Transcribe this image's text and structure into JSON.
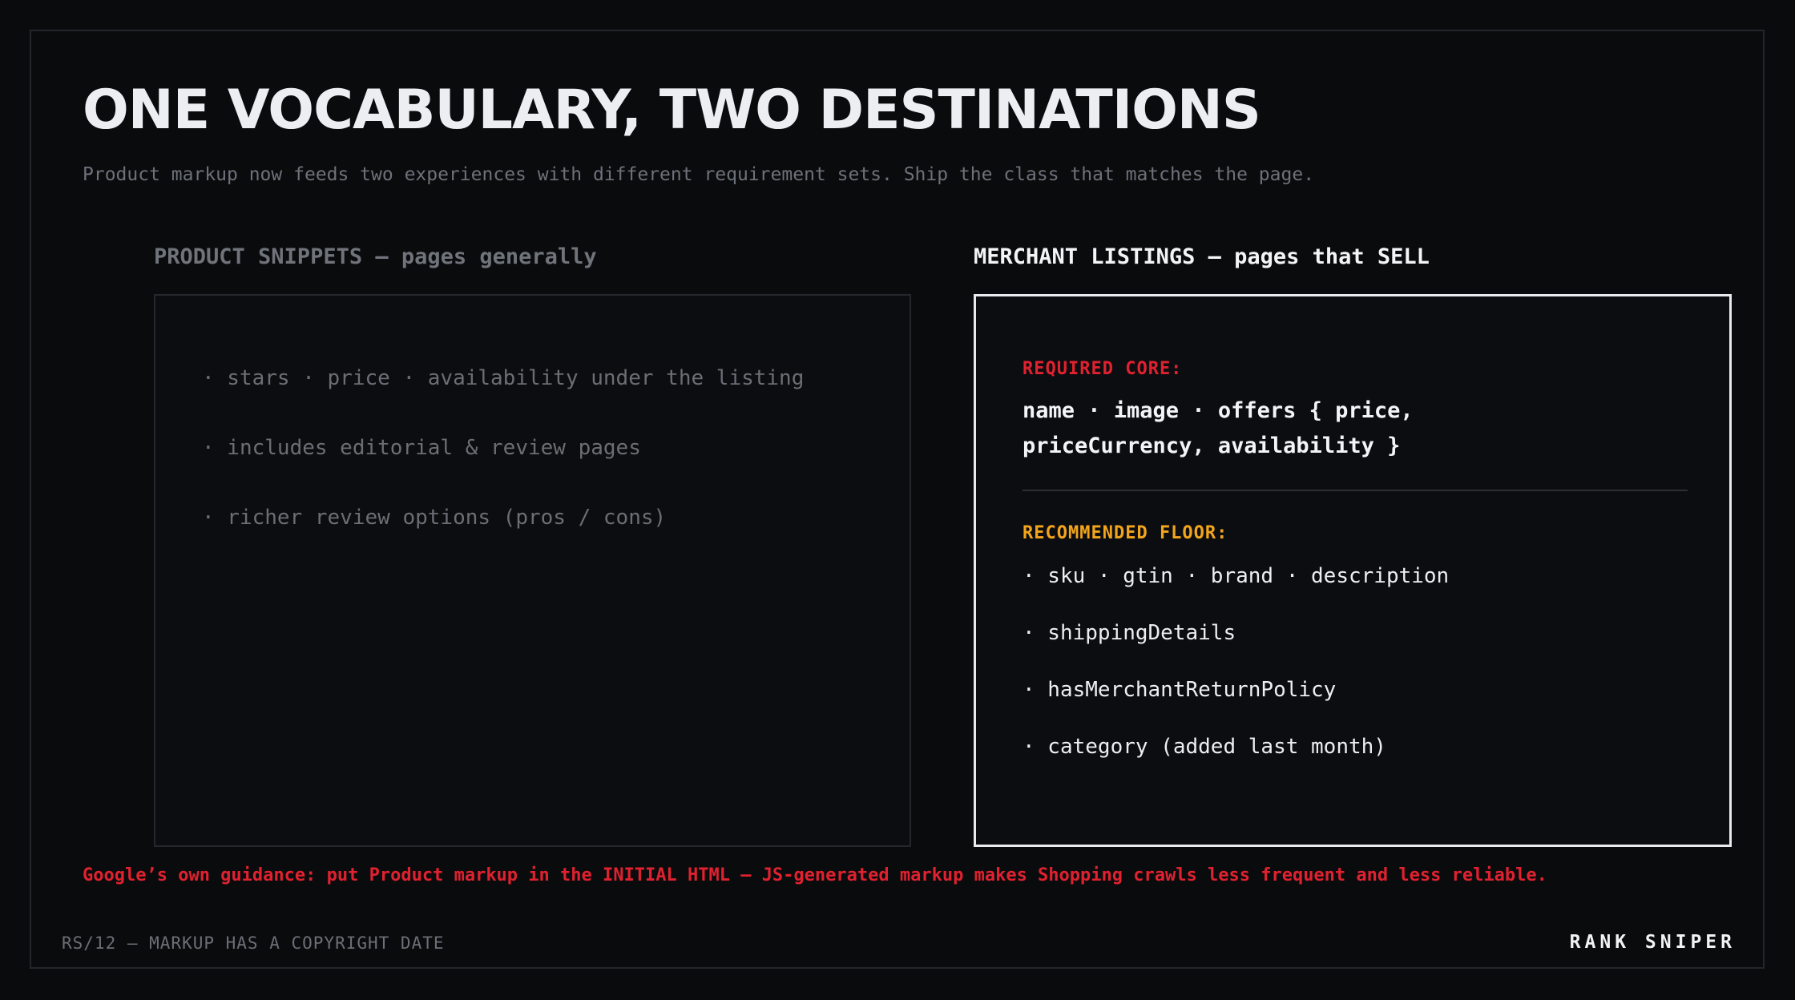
{
  "slide": {
    "title": "ONE VOCABULARY, TWO DESTINATIONS",
    "subtitle": "Product markup now feeds two experiences with different requirement sets. Ship the class that matches the page."
  },
  "left_column": {
    "heading": "PRODUCT SNIPPETS — pages generally",
    "items": [
      "· stars · price · availability under the listing",
      "· includes editorial & review pages",
      "· richer review options (pros / cons)"
    ]
  },
  "right_column": {
    "heading": "MERCHANT LISTINGS — pages that SELL",
    "required_label": "REQUIRED CORE:",
    "required_line1": "name · image · offers { price,",
    "required_line2": "priceCurrency, availability }",
    "recommended_label": "RECOMMENDED FLOOR:",
    "recommended_items": [
      "· sku · gtin · brand · description",
      "· shippingDetails",
      "· hasMerchantReturnPolicy",
      "· category (added last month)"
    ]
  },
  "note": "Google’s own guidance: put Product markup in the INITIAL HTML — JS-generated markup makes Shopping crawls less frequent and less reliable.",
  "footer": {
    "left": "RS/12 — MARKUP HAS A COPYRIGHT DATE",
    "right": "RANK SNIPER"
  },
  "colors": {
    "background": "#0a0b0d",
    "required_accent": "#e0212f",
    "recommended_accent": "#f2a51c",
    "panel_border_active": "#e9ebef"
  }
}
